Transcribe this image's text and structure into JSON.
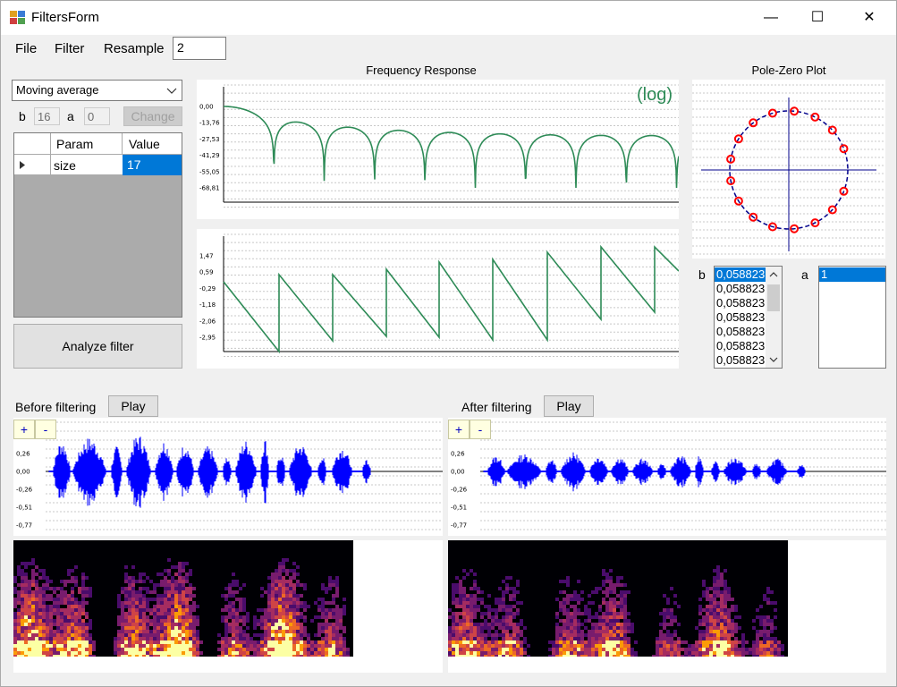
{
  "window": {
    "title": "FiltersForm",
    "minimize": "—",
    "maximize": "☐",
    "close": "✕"
  },
  "menu": {
    "file": "File",
    "filter": "Filter",
    "resample": "Resample",
    "resample_value": "2"
  },
  "filter_type": {
    "selected": "Moving average"
  },
  "coeffs": {
    "b_label": "b",
    "b_value": "16",
    "a_label": "a",
    "a_value": "0",
    "change_label": "Change"
  },
  "params_table": {
    "headers": [
      "Param",
      "Value"
    ],
    "rows": [
      {
        "param": "size",
        "value": "17"
      }
    ]
  },
  "analyze_label": "Analyze filter",
  "freq_title": "Frequency Response",
  "log_label": "(log)",
  "magnitude": {
    "ticks": [
      "0,00",
      "-13,76",
      "-27,53",
      "-41,29",
      "-55,05",
      "-68,81"
    ],
    "filter_length": 17
  },
  "phase": {
    "ticks": [
      "1,47",
      "0,59",
      "-0,29",
      "-1,18",
      "-2,06",
      "-2,95"
    ]
  },
  "pz_title": "Pole-Zero Plot",
  "pz": {
    "zeros_count": 16,
    "circle_color": "#00008b",
    "zero_color": "#ff0000"
  },
  "b_list": {
    "label": "b",
    "items": [
      "0,058823",
      "0,058823",
      "0,058823",
      "0,058823",
      "0,058823",
      "0,058823",
      "0,058823"
    ]
  },
  "a_list": {
    "label": "a",
    "items": [
      "1"
    ]
  },
  "before": {
    "label": "Before filtering",
    "play": "Play",
    "zoom_in": "+",
    "zoom_out": "-",
    "ticks": [
      "0,26",
      "0,00",
      "-0,26",
      "-0,51",
      "-0,77"
    ]
  },
  "after": {
    "label": "After filtering",
    "play": "Play",
    "zoom_in": "+",
    "zoom_out": "-",
    "ticks": [
      "0,26",
      "0,00",
      "-0,26",
      "-0,51",
      "-0,77"
    ]
  },
  "colors": {
    "response": "#2e8b57",
    "waveform": "#0000ff",
    "selection": "#0078d7"
  }
}
